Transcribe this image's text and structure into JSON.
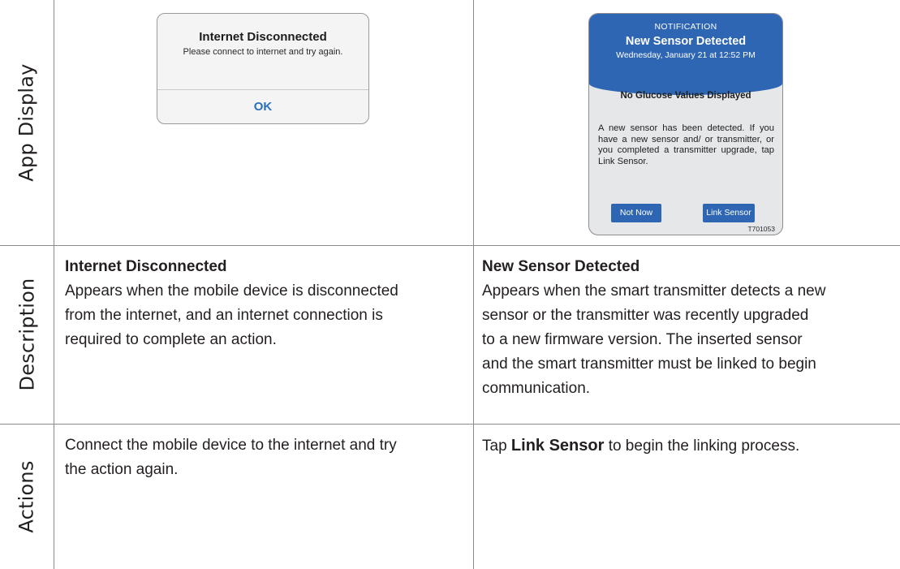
{
  "row_headers": {
    "app_display": "App Display",
    "description": "Description",
    "actions": "Actions"
  },
  "internet_disconnected": {
    "alert": {
      "title": "Internet Disconnected",
      "message": "Please connect to internet and try again.",
      "ok_label": "OK"
    },
    "description_title": "Internet Disconnected",
    "description_lines": [
      "Appears when the mobile device is disconnected",
      "from the internet, and an internet connection is",
      "required to complete an action."
    ],
    "action_lines": [
      "Connect the mobile device to the internet and try",
      "the action again."
    ]
  },
  "new_sensor_detected": {
    "notification": {
      "label": "NOTIFICATION",
      "title": "New Sensor Detected",
      "datetime": "Wednesday, January 21 at 12:52 PM",
      "no_glucose": "No Glucose Values Displayed",
      "body": "A new sensor has been detected. If you have a new sensor and/ or transmitter, or you completed a transmitter upgrade, tap Link Sensor.",
      "not_now_label": "Not Now",
      "link_sensor_label": "Link Sensor",
      "image_code": "T701053"
    },
    "description_title": "New Sensor Detected",
    "description_lines": [
      "Appears when the smart transmitter detects a new",
      "sensor or the transmitter was recently upgraded",
      "to a new firmware version. The inserted sensor",
      "and the smart transmitter must be linked to begin",
      "communication."
    ],
    "action_prefix": "Tap",
    "action_strong": "Link Sensor",
    "action_suffix": "to begin the linking process."
  }
}
